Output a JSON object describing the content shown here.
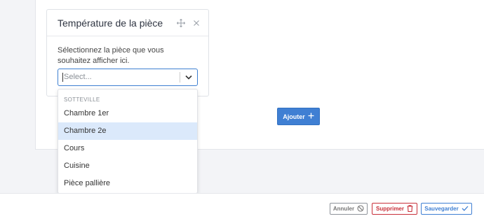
{
  "widget": {
    "title": "Température de la pièce",
    "description": "Sélectionnez la pièce que vous souhaitez afficher ici.",
    "move_icon": "move-icon",
    "close_icon": "close-icon"
  },
  "select": {
    "placeholder": "Select...",
    "chevron_icon": "chevron-down-icon"
  },
  "dropdown": {
    "group_label": "SOTTEVILLE",
    "options": [
      "Chambre 1er",
      "Chambre 2e",
      "Cours",
      "Cuisine",
      "Pièce pallière"
    ],
    "highlighted": "Chambre 2e"
  },
  "add_button": {
    "label": "Ajouter",
    "icon": "plus-icon"
  },
  "footer": {
    "cancel_label": "Annuler",
    "delete_label": "Supprimer",
    "save_label": "Sauvegarder"
  },
  "colors": {
    "accent": "#3f7fd3",
    "danger": "#c8303a",
    "highlight": "#dbe9fb"
  }
}
